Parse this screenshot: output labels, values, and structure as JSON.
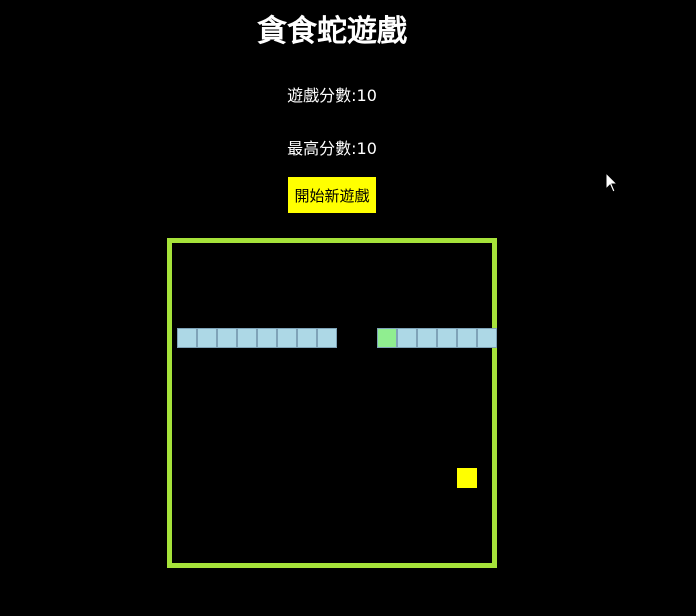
{
  "game": {
    "title": "貪食蛇遊戲",
    "score_label": "遊戲分數:",
    "score": "10",
    "best_label": "最高分數:",
    "best": "10",
    "new_game_label": "開始新遊戲"
  },
  "colors": {
    "background": "#000000",
    "text": "#ffffff",
    "board_border": "#a6e23a",
    "snake_body": "#add8e6",
    "snake_head": "#90ee90",
    "food": "#ffff00",
    "button_bg": "#ffff00"
  },
  "board": {
    "columns": 16,
    "rows": 16,
    "snake": [
      {
        "col": 10,
        "row": 4,
        "head": true
      },
      {
        "col": 11,
        "row": 4
      },
      {
        "col": 12,
        "row": 4
      },
      {
        "col": 13,
        "row": 4
      },
      {
        "col": 14,
        "row": 4
      },
      {
        "col": 15,
        "row": 4
      },
      {
        "col": 0,
        "row": 4
      },
      {
        "col": 1,
        "row": 4
      },
      {
        "col": 2,
        "row": 4
      },
      {
        "col": 3,
        "row": 4
      },
      {
        "col": 4,
        "row": 4
      },
      {
        "col": 5,
        "row": 4
      },
      {
        "col": 6,
        "row": 4
      },
      {
        "col": 7,
        "row": 4
      }
    ],
    "food": {
      "col": 14,
      "row": 11
    }
  },
  "icons": {
    "cursor": "mouse-pointer-icon"
  }
}
